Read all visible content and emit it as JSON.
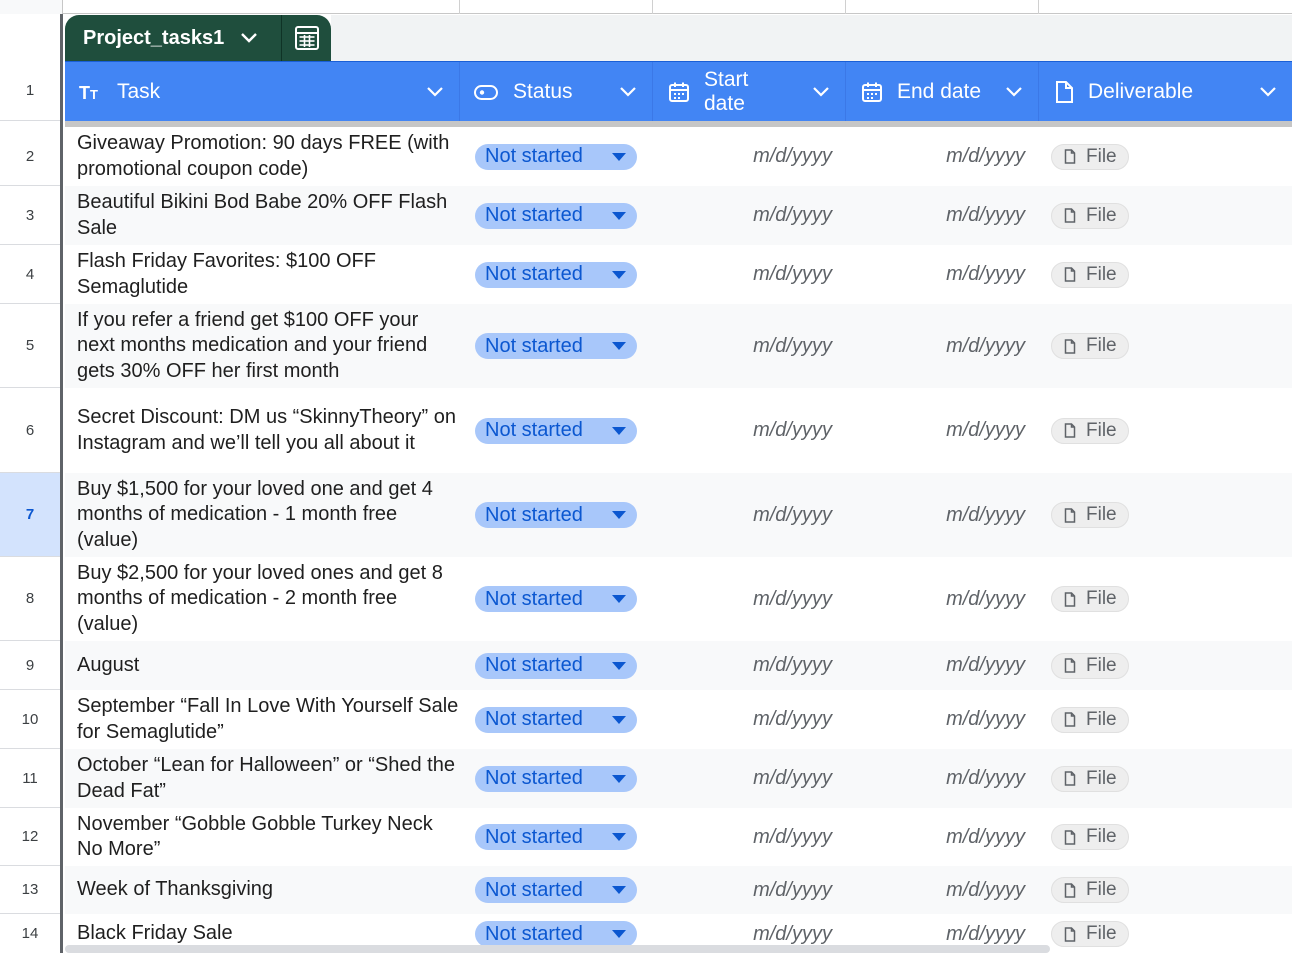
{
  "table": {
    "name": "Project_tasks1"
  },
  "columns": {
    "task": "Task",
    "status": "Status",
    "start_date": [
      "Start",
      "date"
    ],
    "end_date": "End date",
    "deliverable": "Deliverable"
  },
  "header_row_number": "1",
  "selected_row": "7",
  "rows": [
    {
      "num": "2",
      "task": "Giveaway Promotion: 90 days FREE (with promotional coupon code)",
      "status": "Not started",
      "start": "m/d/yyyy",
      "end": "m/d/yyyy",
      "deliverable": "File"
    },
    {
      "num": "3",
      "task": "Beautiful Bikini Bod Babe 20% OFF Flash Sale",
      "status": "Not started",
      "start": "m/d/yyyy",
      "end": "m/d/yyyy",
      "deliverable": "File"
    },
    {
      "num": "4",
      "task": "Flash Friday Favorites: $100 OFF Semaglutide",
      "status": "Not started",
      "start": "m/d/yyyy",
      "end": "m/d/yyyy",
      "deliverable": "File"
    },
    {
      "num": "5",
      "task": "If you refer a friend get $100 OFF your next months medication and your friend gets 30% OFF her first month",
      "status": "Not started",
      "start": "m/d/yyyy",
      "end": "m/d/yyyy",
      "deliverable": "File"
    },
    {
      "num": "6",
      "task": "Secret Discount: DM us “SkinnyTheory” on Instagram and we’ll tell you all about it",
      "status": "Not started",
      "start": "m/d/yyyy",
      "end": "m/d/yyyy",
      "deliverable": "File"
    },
    {
      "num": "7",
      "task": "Buy $1,500 for your loved one and get 4 months of medication - 1 month free (value)",
      "status": "Not started",
      "start": "m/d/yyyy",
      "end": "m/d/yyyy",
      "deliverable": "File"
    },
    {
      "num": "8",
      "task": "Buy $2,500 for your loved ones and get 8 months of medication - 2 month free (value)",
      "status": "Not started",
      "start": "m/d/yyyy",
      "end": "m/d/yyyy",
      "deliverable": "File"
    },
    {
      "num": "9",
      "task": "August",
      "status": "Not started",
      "start": "m/d/yyyy",
      "end": "m/d/yyyy",
      "deliverable": "File"
    },
    {
      "num": "10",
      "task": "September “Fall In Love With Yourself Sale for Semaglutide”",
      "status": "Not started",
      "start": "m/d/yyyy",
      "end": "m/d/yyyy",
      "deliverable": "File"
    },
    {
      "num": "11",
      "task": "October “Lean for Halloween” or “Shed the Dead Fat”",
      "status": "Not started",
      "start": "m/d/yyyy",
      "end": "m/d/yyyy",
      "deliverable": "File"
    },
    {
      "num": "12",
      "task": "November “Gobble Gobble Turkey Neck No More”",
      "status": "Not started",
      "start": "m/d/yyyy",
      "end": "m/d/yyyy",
      "deliverable": "File"
    },
    {
      "num": "13",
      "task": "Week of Thanksgiving",
      "status": "Not started",
      "start": "m/d/yyyy",
      "end": "m/d/yyyy",
      "deliverable": "File"
    },
    {
      "num": "14",
      "task": "Black Friday Sale",
      "status": "Not started",
      "start": "m/d/yyyy",
      "end": "m/d/yyyy",
      "deliverable": "File"
    }
  ],
  "icons": {
    "table_dropdown": "chevron-down-icon",
    "table_view": "table-grid-icon",
    "task_type": "text-type-icon",
    "status_type": "chip-icon",
    "date_type": "calendar-icon",
    "file_type": "document-icon"
  },
  "colors": {
    "header_blue": "#4285f4",
    "tab_green": "#1f4e3d",
    "status_chip": "#a8c7fa",
    "status_text": "#0b57d0",
    "selected_row": "#d3e3fd"
  }
}
